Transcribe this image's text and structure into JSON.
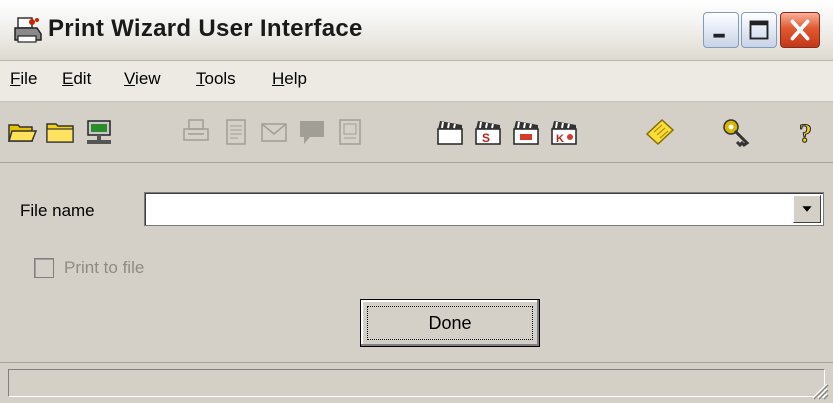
{
  "window": {
    "title": "Print Wizard User Interface"
  },
  "menu": [
    {
      "label": "File",
      "mnemonic": "F",
      "rest": "ile"
    },
    {
      "label": "Edit",
      "mnemonic": "E",
      "rest": "dit"
    },
    {
      "label": "View",
      "mnemonic": "V",
      "rest": "iew"
    },
    {
      "label": "Tools",
      "mnemonic": "T",
      "rest": "ools"
    },
    {
      "label": "Help",
      "mnemonic": "H",
      "rest": "elp"
    }
  ],
  "toolbar": {
    "icons": [
      "open-folder-icon",
      "folder-icon",
      "network-drive-icon",
      "print-icon",
      "document-icon",
      "mail-icon",
      "comment-icon",
      "report-icon",
      "clapper-icon-1",
      "clapper-icon-2",
      "clapper-icon-3",
      "clapper-icon-4",
      "ticket-icon",
      "key-icon",
      "help-icon"
    ],
    "disabled": [
      "print-icon",
      "document-icon",
      "mail-icon",
      "comment-icon",
      "report-icon"
    ]
  },
  "form": {
    "file_name_label": "File name",
    "file_name_value": "",
    "print_to_file_label": "Print to file",
    "print_to_file_checked": false,
    "print_to_file_enabled": false,
    "done_label": "Done"
  },
  "status": {
    "text": ""
  }
}
